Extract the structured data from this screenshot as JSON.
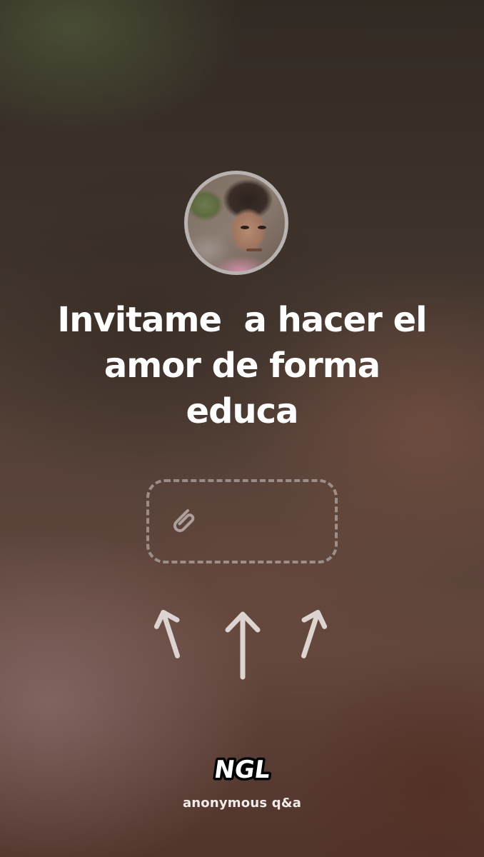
{
  "question": {
    "text": "Invitame  a hacer el\namor de forma\neduca"
  },
  "avatar": {
    "icon": "profile-photo"
  },
  "dropzone": {
    "icon": "paperclip-icon"
  },
  "arrows": {
    "icon": "up-arrow-icon",
    "count": 3
  },
  "brand": {
    "logo_text": "NGL",
    "tagline": "anonymous q&a"
  },
  "colors": {
    "text": "#ffffff",
    "dashed_border": "#c8bebc",
    "arrow": "#ddd3d0",
    "avatar_ring": "#b8b3b0"
  }
}
